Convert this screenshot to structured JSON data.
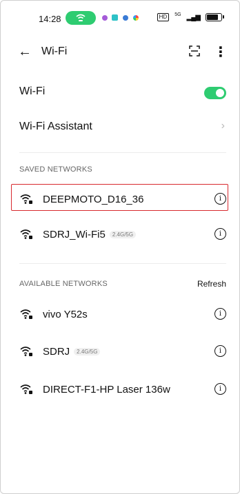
{
  "status_bar": {
    "time": "14:28",
    "hd_label": "HD",
    "network_label": "5G",
    "signal_glyph": "▂▄▆"
  },
  "header": {
    "back_icon": "arrow-left",
    "title": "Wi-Fi",
    "scan_icon": "qr-scan",
    "more_icon": "vertical-more"
  },
  "wifi": {
    "label": "Wi-Fi",
    "enabled": true,
    "accent": "#2ecc71"
  },
  "assistant": {
    "label": "Wi-Fi Assistant",
    "chevron": "›"
  },
  "saved": {
    "title": "SAVED NETWORKS",
    "items": [
      {
        "name": "DEEPMOTO_D16_36",
        "badge": ""
      },
      {
        "name": "SDRJ_Wi-Fi5",
        "badge": "2.4G/5G"
      }
    ]
  },
  "available": {
    "title": "AVAILABLE NETWORKS",
    "refresh_label": "Refresh",
    "items": [
      {
        "name": "vivo Y52s",
        "badge": ""
      },
      {
        "name": "SDRJ",
        "badge": "2.4G/5G"
      },
      {
        "name": "DIRECT-F1-HP Laser 136w",
        "badge": ""
      }
    ]
  },
  "info_glyph": "i",
  "highlight_color": "#d8282d"
}
